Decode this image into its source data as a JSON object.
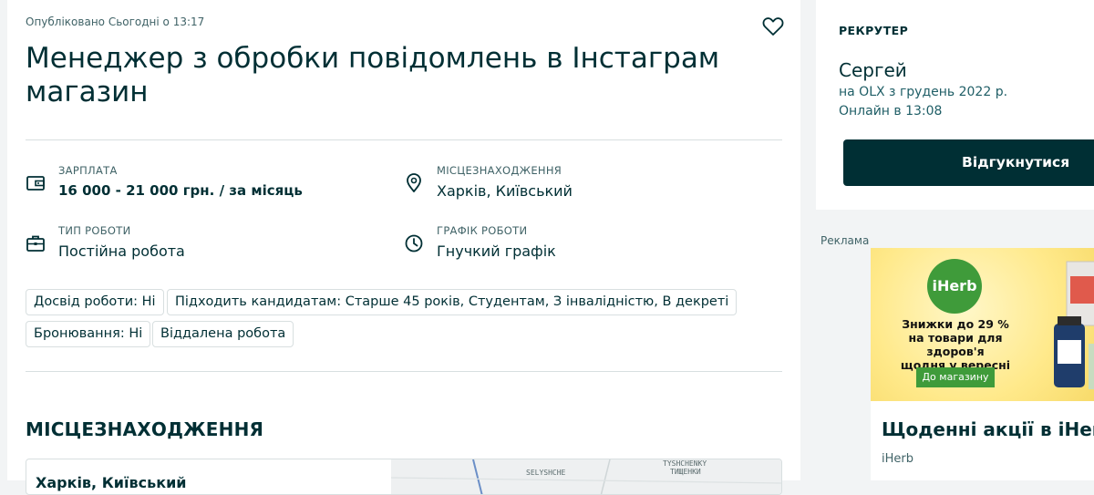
{
  "ad": {
    "label": "Реклама",
    "logo_text": "iHerb",
    "line1": "Знижки до 29 %",
    "line2": "на товари для здоров'я",
    "line3": "щодня у вересні",
    "button": "До магазину",
    "title": "Щоденні акції в iHerb",
    "brand": "iHerb"
  },
  "listing": {
    "published": "Опубліковано Сьогодні о 13:17",
    "title": "Менеджер з обробки повідомлень в Інстаграм магазин",
    "favorite_icon": "heart-icon",
    "salary_label": "ЗАРПЛАТА",
    "salary_value": "16 000 - 21 000 грн. / за місяць",
    "location_label": "МІСЦЕЗНАХОДЖЕННЯ",
    "location_value": "Харків, Київський",
    "work_type_label": "ТИП РОБОТИ",
    "work_type_value": "Постійна робота",
    "schedule_label": "ГРАФІК РОБОТИ",
    "schedule_value": "Гнучкий графік",
    "chips": [
      "Досвід роботи: Ні",
      "Підходить кандидатам: Старше 45 років, Студентам, З інвалідністю, В декреті",
      "Бронювання: Ні",
      "Віддалена робота"
    ],
    "location_heading": "МІСЦЕЗНАХОДЖЕННЯ",
    "map_address": "Харків, Київський",
    "map_labels": [
      "SELYSHCHE",
      "TYSHCHENKY",
      "ТИЩЕНКИ"
    ]
  },
  "recruiter": {
    "heading": "РЕКРУТЕР",
    "name": "Сергей",
    "since": "на OLX з грудень 2022 р.",
    "online": "Онлайн в 13:08",
    "respond_button": "Відгукнутися"
  },
  "colors": {
    "primary": "#002f34",
    "muted": "#406367",
    "border": "#d8dfe0",
    "iherb_green": "#3f9b3a"
  }
}
